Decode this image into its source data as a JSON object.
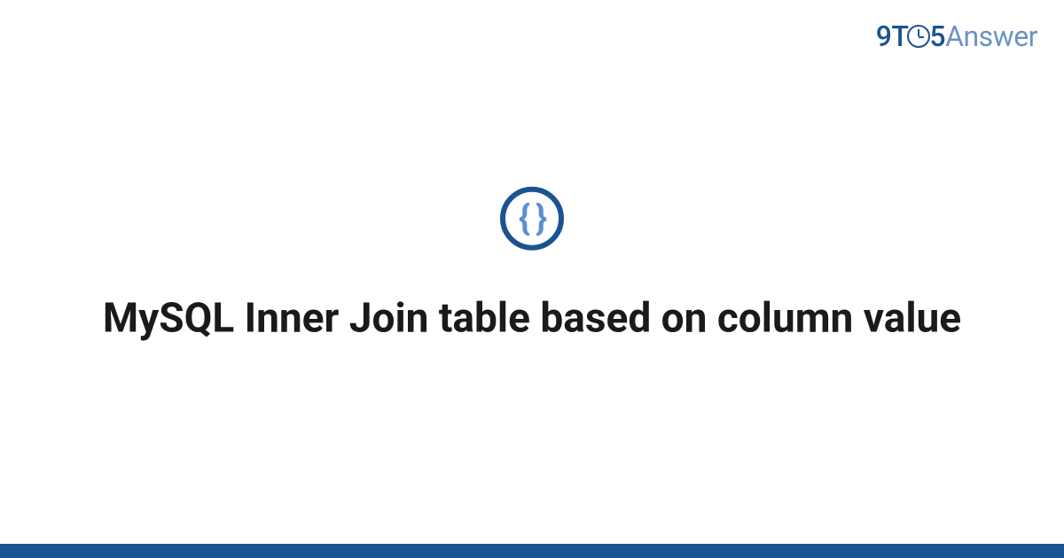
{
  "logo": {
    "part1": "9",
    "part2": "T",
    "part3": "5",
    "part4": "Answer"
  },
  "icon": {
    "name": "code-braces-icon",
    "glyph": "{ }"
  },
  "title": "MySQL Inner Join table based on column value",
  "colors": {
    "brand_dark": "#1a5490",
    "brand_light": "#6b93c4",
    "icon_braces": "#5a8fd4",
    "text": "#1a1a1a"
  }
}
